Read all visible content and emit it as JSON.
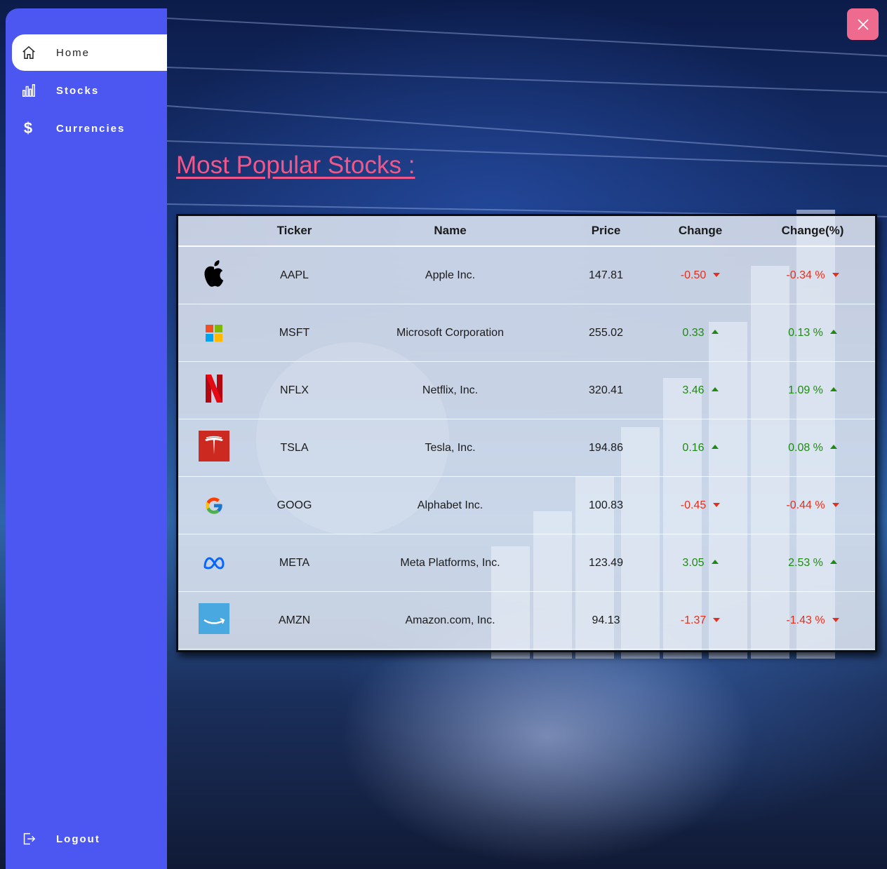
{
  "sidebar": {
    "items": [
      {
        "label": "Home",
        "icon": "home-icon",
        "active": true
      },
      {
        "label": "Stocks",
        "icon": "bar-chart-icon",
        "active": false
      },
      {
        "label": "Currencies",
        "icon": "dollar-icon",
        "active": false
      }
    ],
    "logout_label": "Logout"
  },
  "page": {
    "title": "Most Popular Stocks :"
  },
  "table": {
    "headers": [
      "",
      "Ticker",
      "Name",
      "Price",
      "Change",
      "Change(%)"
    ],
    "rows": [
      {
        "logo": "apple-logo",
        "ticker": "AAPL",
        "name": "Apple Inc.",
        "price": "147.81",
        "change": "-0.50",
        "change_pct": "-0.34 %",
        "direction": "down"
      },
      {
        "logo": "microsoft-logo",
        "ticker": "MSFT",
        "name": "Microsoft Corporation",
        "price": "255.02",
        "change": "0.33",
        "change_pct": "0.13 %",
        "direction": "up"
      },
      {
        "logo": "netflix-logo",
        "ticker": "NFLX",
        "name": "Netflix, Inc.",
        "price": "320.41",
        "change": "3.46",
        "change_pct": "1.09 %",
        "direction": "up"
      },
      {
        "logo": "tesla-logo",
        "ticker": "TSLA",
        "name": "Tesla, Inc.",
        "price": "194.86",
        "change": "0.16",
        "change_pct": "0.08 %",
        "direction": "up"
      },
      {
        "logo": "google-logo",
        "ticker": "GOOG",
        "name": "Alphabet Inc.",
        "price": "100.83",
        "change": "-0.45",
        "change_pct": "-0.44 %",
        "direction": "down"
      },
      {
        "logo": "meta-logo",
        "ticker": "META",
        "name": "Meta Platforms, Inc.",
        "price": "123.49",
        "change": "3.05",
        "change_pct": "2.53 %",
        "direction": "up"
      },
      {
        "logo": "amazon-logo",
        "ticker": "AMZN",
        "name": "Amazon.com, Inc.",
        "price": "94.13",
        "change": "-1.37",
        "change_pct": "-1.43 %",
        "direction": "down"
      }
    ]
  },
  "colors": {
    "sidebar": "#4b57f0",
    "title": "#f0588a",
    "close_button": "#ef6a8f",
    "up": "#1f8a12",
    "down": "#e2301e"
  }
}
